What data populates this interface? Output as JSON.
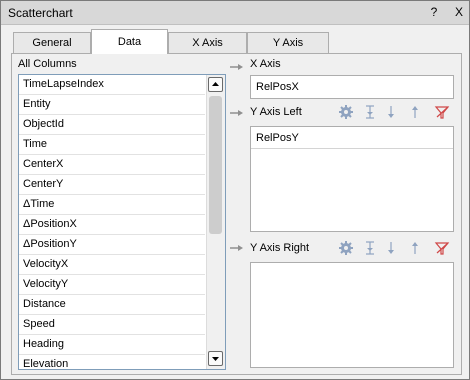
{
  "window": {
    "title": "Scatterchart",
    "help_label": "?",
    "close_label": "X"
  },
  "tabs": [
    {
      "label": "General",
      "active": false
    },
    {
      "label": "Data",
      "active": true
    },
    {
      "label": "X Axis",
      "active": false
    },
    {
      "label": "Y Axis",
      "active": false
    }
  ],
  "columns": {
    "header": "All Columns",
    "items": [
      "TimeLapseIndex",
      "Entity",
      "ObjectId",
      "Time",
      "CenterX",
      "CenterY",
      "ΔTime",
      "ΔPositionX",
      "ΔPositionY",
      "VelocityX",
      "VelocityY",
      "Distance",
      "Speed",
      "Heading",
      "Elevation"
    ]
  },
  "x_axis": {
    "label": "X Axis",
    "value": "RelPosX"
  },
  "y_left": {
    "label": "Y Axis Left",
    "items": [
      "RelPosY"
    ]
  },
  "y_right": {
    "label": "Y Axis Right",
    "items": []
  },
  "icons": {
    "settings": "gear-icon",
    "move_top": "move-top-icon",
    "move_down": "arrow-down-icon",
    "move_up": "arrow-up-icon",
    "remove": "clear-filter-icon"
  },
  "colors": {
    "accent_icon": "#8fa3c0",
    "remove_icon": "#d04848",
    "selected_border": "#7f9db9"
  }
}
